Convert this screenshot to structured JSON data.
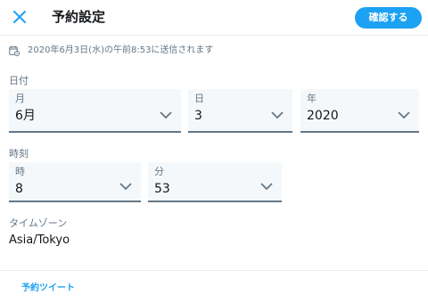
{
  "header": {
    "title": "予約設定",
    "confirm_label": "確認する",
    "close_icon": "close-icon"
  },
  "schedule": {
    "icon": "calendar-clock-icon",
    "text": "2020年6月3日(水)の午前8:53に送信されます"
  },
  "date": {
    "section_label": "日付",
    "month": {
      "label": "月",
      "value": "6月"
    },
    "day": {
      "label": "日",
      "value": "3"
    },
    "year": {
      "label": "年",
      "value": "2020"
    }
  },
  "time": {
    "section_label": "時刻",
    "hour": {
      "label": "時",
      "value": "8"
    },
    "minute": {
      "label": "分",
      "value": "53"
    }
  },
  "timezone": {
    "label": "タイムゾーン",
    "value": "Asia/Tokyo"
  },
  "footer": {
    "link_label": "予約ツイート"
  },
  "colors": {
    "accent": "#1da1f2",
    "field_bg": "#f5f8fa",
    "muted_text": "#657786"
  }
}
